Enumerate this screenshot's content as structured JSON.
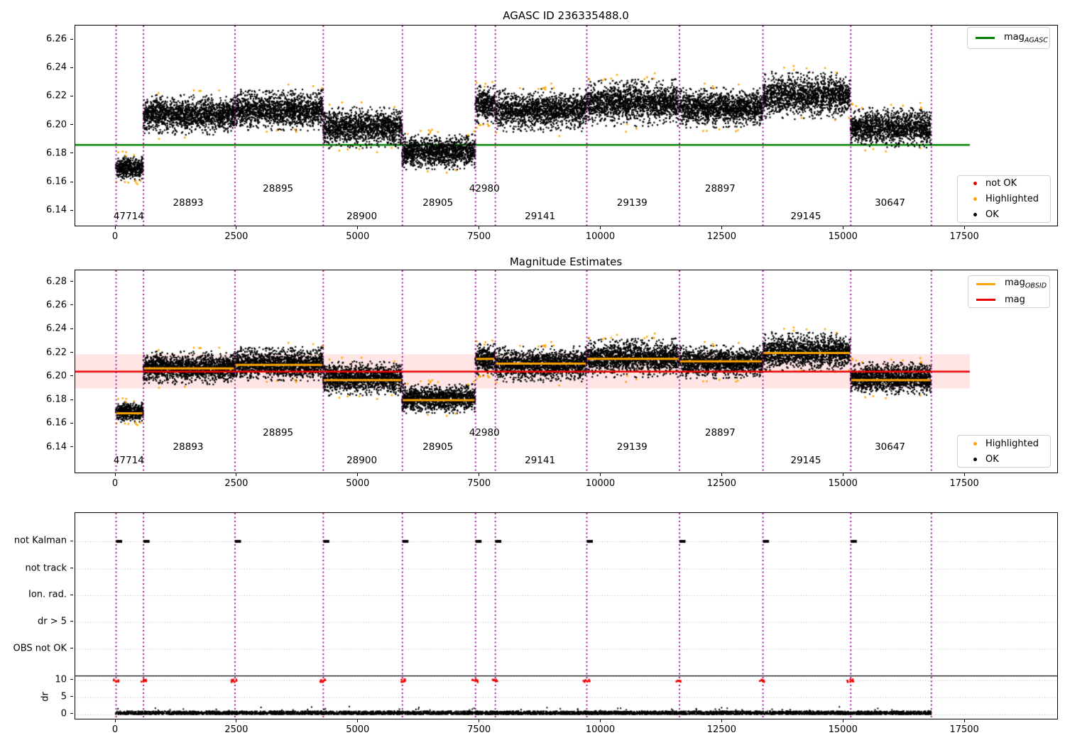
{
  "titles": {
    "top": "AGASC ID 236335488.0",
    "middle": "Magnitude Estimates"
  },
  "legends": {
    "mag_agasc": {
      "prefix": "mag",
      "sub": "AGASC"
    },
    "mag_obsid": {
      "prefix": "mag",
      "sub": "OBSID"
    },
    "mag": "mag",
    "not_ok": "not OK",
    "highlighted_top": "Highlighted",
    "ok_top": "OK",
    "highlighted_mid": "Highlighted",
    "ok_mid": "OK"
  },
  "colors": {
    "green_line": "#008000",
    "orange": "#ffa500",
    "red": "#ee0000",
    "band_fill": "rgba(255,0,0,0.10)",
    "black": "#000000",
    "purple_dotted": "#8f008f",
    "gridline": "#b5b5b5"
  },
  "bottom_axis": {
    "rows": [
      "not Kalman",
      "not track",
      "Ion. rad.",
      "dr > 5",
      "OBS not OK"
    ],
    "dr_label": "dr",
    "dr_ticks": [
      "10",
      "5",
      "0"
    ]
  },
  "chart_data": {
    "type": "scatter",
    "x_axis": {
      "range": [
        -834,
        19400
      ],
      "ticks": [
        0,
        2500,
        5000,
        7500,
        10000,
        12500,
        15000,
        17500
      ],
      "tick_labels": [
        "0",
        "2500",
        "5000",
        "7500",
        "10000",
        "12500",
        "15000",
        "17500"
      ]
    },
    "obs_boundaries_x": [
      0,
      565,
      2450,
      4270,
      5900,
      7407,
      7815,
      9700,
      11610,
      13330,
      15140,
      16800
    ],
    "ref_lines_end_x": 17600,
    "observations": [
      {
        "obsid": "47714",
        "x0": 0,
        "x1": 565,
        "mag_mean": 6.17,
        "mag_half_spread": 0.009,
        "mag_obsid": 6.169,
        "label_level": 0
      },
      {
        "obsid": "28893",
        "x0": 565,
        "x1": 2450,
        "mag_mean": 6.2075,
        "mag_half_spread": 0.0135,
        "mag_obsid": 6.207,
        "label_level": 1
      },
      {
        "obsid": "28895",
        "x0": 2450,
        "x1": 4270,
        "mag_mean": 6.2105,
        "mag_half_spread": 0.014,
        "mag_obsid": 6.21,
        "label_level": 2
      },
      {
        "obsid": "28900",
        "x0": 4270,
        "x1": 5900,
        "mag_mean": 6.1985,
        "mag_half_spread": 0.014,
        "mag_obsid": 6.197,
        "label_level": 0
      },
      {
        "obsid": "28905",
        "x0": 5900,
        "x1": 7407,
        "mag_mean": 6.1815,
        "mag_half_spread": 0.012,
        "mag_obsid": 6.18,
        "label_level": 1
      },
      {
        "obsid": "42980",
        "x0": 7407,
        "x1": 7815,
        "mag_mean": 6.2145,
        "mag_half_spread": 0.013,
        "mag_obsid": 6.215,
        "label_level": 2
      },
      {
        "obsid": "29141",
        "x0": 7815,
        "x1": 9700,
        "mag_mean": 6.2105,
        "mag_half_spread": 0.0145,
        "mag_obsid": 6.211,
        "label_level": 0
      },
      {
        "obsid": "29139",
        "x0": 9700,
        "x1": 11610,
        "mag_mean": 6.216,
        "mag_half_spread": 0.016,
        "mag_obsid": 6.215,
        "label_level": 1
      },
      {
        "obsid": "28897",
        "x0": 11610,
        "x1": 13330,
        "mag_mean": 6.2125,
        "mag_half_spread": 0.0135,
        "mag_obsid": 6.213,
        "label_level": 2
      },
      {
        "obsid": "29145",
        "x0": 13330,
        "x1": 15140,
        "mag_mean": 6.221,
        "mag_half_spread": 0.016,
        "mag_obsid": 6.22,
        "label_level": 0
      },
      {
        "obsid": "30647",
        "x0": 15140,
        "x1": 16800,
        "mag_mean": 6.1985,
        "mag_half_spread": 0.0135,
        "mag_obsid": 6.197,
        "label_level": 1
      }
    ],
    "top_plot": {
      "title": "AGASC ID 236335488.0",
      "ylim": [
        6.1297,
        6.27
      ],
      "yticks": [
        6.14,
        6.16,
        6.18,
        6.2,
        6.22,
        6.24,
        6.26
      ],
      "ytick_labels": [
        "6.14",
        "6.16",
        "6.18",
        "6.20",
        "6.22",
        "6.24",
        "6.26"
      ],
      "mag_agasc": 6.1865,
      "series": [
        "OK",
        "Highlighted",
        "not OK"
      ]
    },
    "middle_plot": {
      "title": "Magnitude Estimates",
      "ylim": [
        6.1188,
        6.29
      ],
      "yticks": [
        6.14,
        6.16,
        6.18,
        6.2,
        6.22,
        6.24,
        6.26,
        6.28
      ],
      "ytick_labels": [
        "6.14",
        "6.16",
        "6.18",
        "6.20",
        "6.22",
        "6.24",
        "6.26",
        "6.28"
      ],
      "mag": 6.2045,
      "mag_band": [
        6.19,
        6.219
      ],
      "series": [
        "OK",
        "Highlighted",
        "mag_OBSID per observation"
      ]
    },
    "bottom_plot": {
      "rows": [
        "not Kalman",
        "not track",
        "Ion. rad.",
        "dr > 5",
        "OBS not OK"
      ],
      "row_fracs": [
        0.138,
        0.2714,
        0.4,
        0.53,
        0.661
      ],
      "dr_ticks": [
        10,
        5,
        0
      ],
      "dr_zero_frac": 0.979,
      "dr_unit_frac": 0.0166,
      "separator_frac": 0.792,
      "not_kalman_marker_x": [
        0,
        565,
        2450,
        4270,
        5900,
        7407,
        7815,
        9700,
        11610,
        13330,
        15140
      ],
      "dr_clipped_marker_x": [
        0,
        565,
        2450,
        4270,
        5900,
        7407,
        7815,
        9700,
        11610,
        13330,
        15140
      ],
      "dr_clipped_value": 10,
      "dr_noise_range": [
        0.05,
        0.95
      ],
      "dr_noise_x_extent": [
        0,
        16800
      ]
    }
  },
  "layout_note": "three stacked panels sharing one x axis scale"
}
